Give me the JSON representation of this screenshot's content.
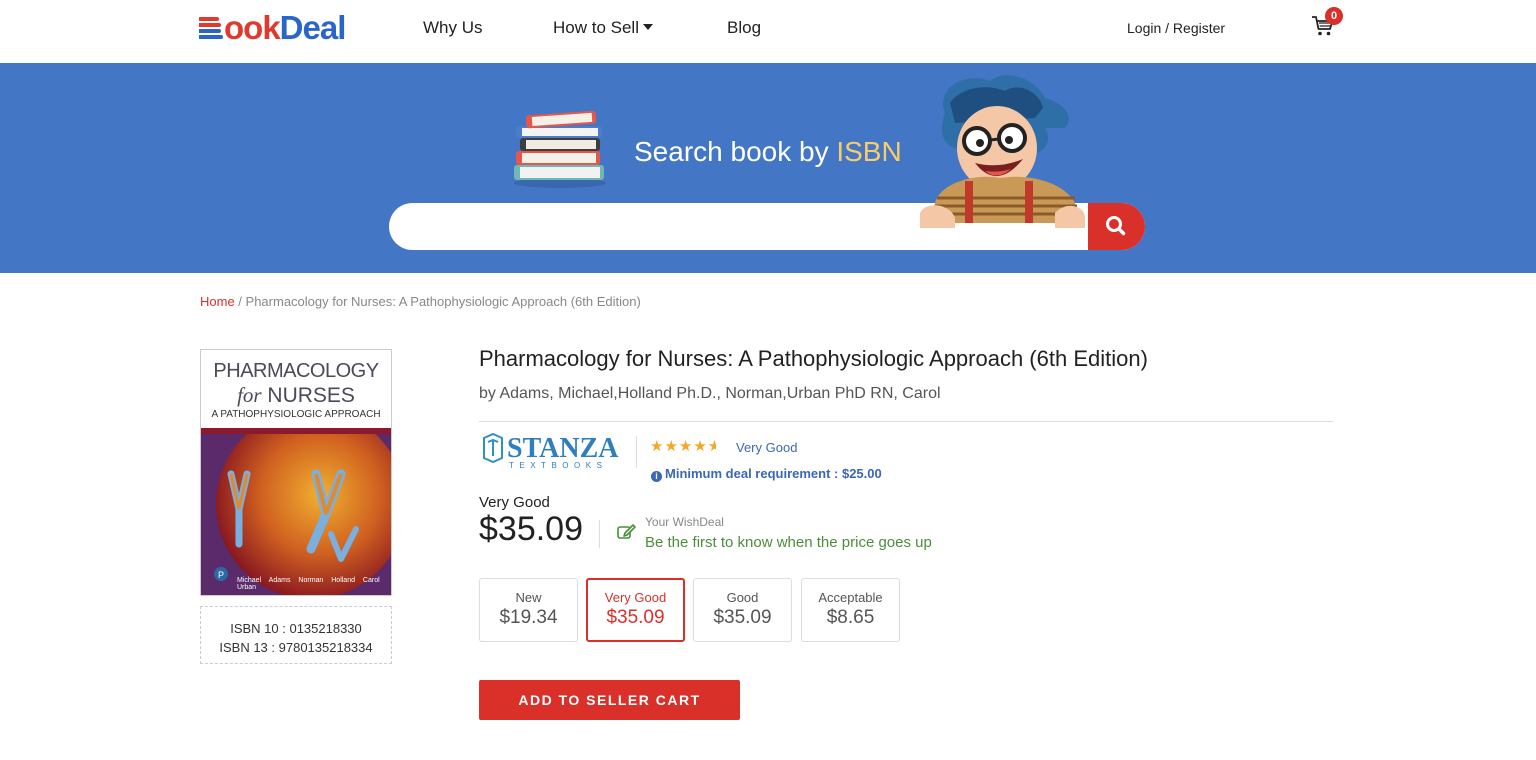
{
  "header": {
    "logo_part1": "ook",
    "logo_part2": "Deal",
    "nav": [
      "Why Us",
      "How to Sell",
      "Blog"
    ],
    "login": "Login / Register",
    "cart_count": "0"
  },
  "hero": {
    "search_prefix": "Search book by ",
    "search_highlight": "ISBN",
    "search_placeholder": ""
  },
  "breadcrumb": {
    "home": "Home",
    "separator": " / ",
    "current": "Pharmacology for Nurses: A Pathophysiologic Approach (6th Edition)"
  },
  "cover": {
    "line1": "PHARMACOLOGY",
    "line2_italic": "for",
    "line2_rest": " NURSES",
    "line3": "A PATHOPHYSIOLOGIC APPROACH",
    "authors": "Michael Adams  Norman Holland  Carol Urban"
  },
  "isbn": {
    "isbn10": "ISBN 10 : 0135218330",
    "isbn13": "ISBN 13 : 9780135218334"
  },
  "book": {
    "title": "Pharmacology for Nurses: A Pathophysiologic Approach (6th Edition)",
    "author": "by Adams, Michael,Holland Ph.D., Norman,Urban PhD RN, Carol"
  },
  "seller": {
    "name": "STANZA",
    "subtitle": "TEXTBOOKS",
    "rating": 4.5,
    "rating_text": "Very Good",
    "min_requirement": "Minimum deal requirement : $25.00"
  },
  "selected": {
    "condition": "Very Good",
    "price": "$35.09"
  },
  "wishdeal": {
    "label": "Your WishDeal",
    "text": "Be the first to know when the price goes up"
  },
  "options": [
    {
      "name": "New",
      "price": "$19.34"
    },
    {
      "name": "Very Good",
      "price": "$35.09"
    },
    {
      "name": "Good",
      "price": "$35.09"
    },
    {
      "name": "Acceptable",
      "price": "$8.65"
    }
  ],
  "add_button": "ADD TO SELLER CART",
  "colors": {
    "brand_red": "#d9302a",
    "brand_blue": "#2a66c9",
    "hero_blue": "#4476c6",
    "accent_yellow": "#f6cd68",
    "wish_green": "#4a8f3a"
  }
}
